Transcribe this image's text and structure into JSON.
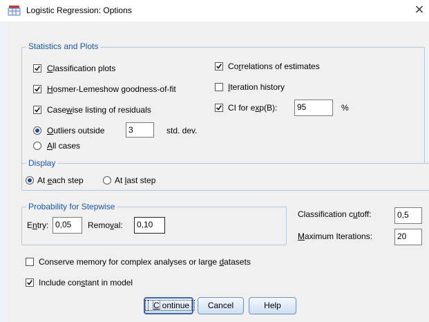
{
  "window": {
    "title": "Logistic Regression: Options",
    "close_label": "×"
  },
  "stats_plots": {
    "group_label": "Statistics and Plots",
    "classification_plots": {
      "pre": "",
      "u": "C",
      "post": "lassification plots",
      "checked": true
    },
    "hosmer": {
      "pre": "",
      "u": "H",
      "post": "osmer-Lemeshow goodness-of-fit",
      "checked": true
    },
    "casewise": {
      "pre": "Case",
      "u": "w",
      "post": "ise listing of residuals",
      "checked": true
    },
    "outliers": {
      "pre": "",
      "u": "O",
      "post": "utliers outside",
      "selected": true,
      "value": "3",
      "unit": "std. dev."
    },
    "all_cases": {
      "pre": "",
      "u": "A",
      "post": "ll cases",
      "selected": false
    },
    "correlations": {
      "pre": "Co",
      "u": "r",
      "post": "relations of estimates",
      "checked": true
    },
    "iteration_history": {
      "pre": "",
      "u": "I",
      "post": "teration history",
      "checked": false
    },
    "ci_expb": {
      "pre": "CI for e",
      "u": "x",
      "post": "p(B):",
      "checked": true,
      "value": "95",
      "unit": "%"
    }
  },
  "display": {
    "group_label": "Display",
    "each_step": {
      "pre": "At ",
      "u": "e",
      "post": "ach step",
      "selected": true
    },
    "last_step": {
      "pre": "At ",
      "u": "l",
      "post": "ast step",
      "selected": false
    }
  },
  "stepwise": {
    "group_label": "Probability for Stepwise",
    "entry": {
      "pre": "E",
      "u": "n",
      "post": "try:",
      "value": "0,05"
    },
    "removal": {
      "pre": "Remo",
      "u": "v",
      "post": "al:",
      "value": "0,10"
    }
  },
  "cutoff": {
    "pre": "Classification c",
    "u": "u",
    "post": "toff:",
    "value": "0,5"
  },
  "max_iter": {
    "pre": "",
    "u": "M",
    "post": "aximum Iterations:",
    "value": "20"
  },
  "conserve_memory": {
    "pre": "Conserve memory for complex analyses or large ",
    "u": "d",
    "post": "atasets",
    "checked": false
  },
  "include_constant": {
    "pre": "Include con",
    "u": "s",
    "post": "tant in model",
    "checked": true
  },
  "buttons": {
    "continue": {
      "pre": "",
      "u": "C",
      "post": "ontinue"
    },
    "cancel": "Cancel",
    "help": "Help"
  }
}
